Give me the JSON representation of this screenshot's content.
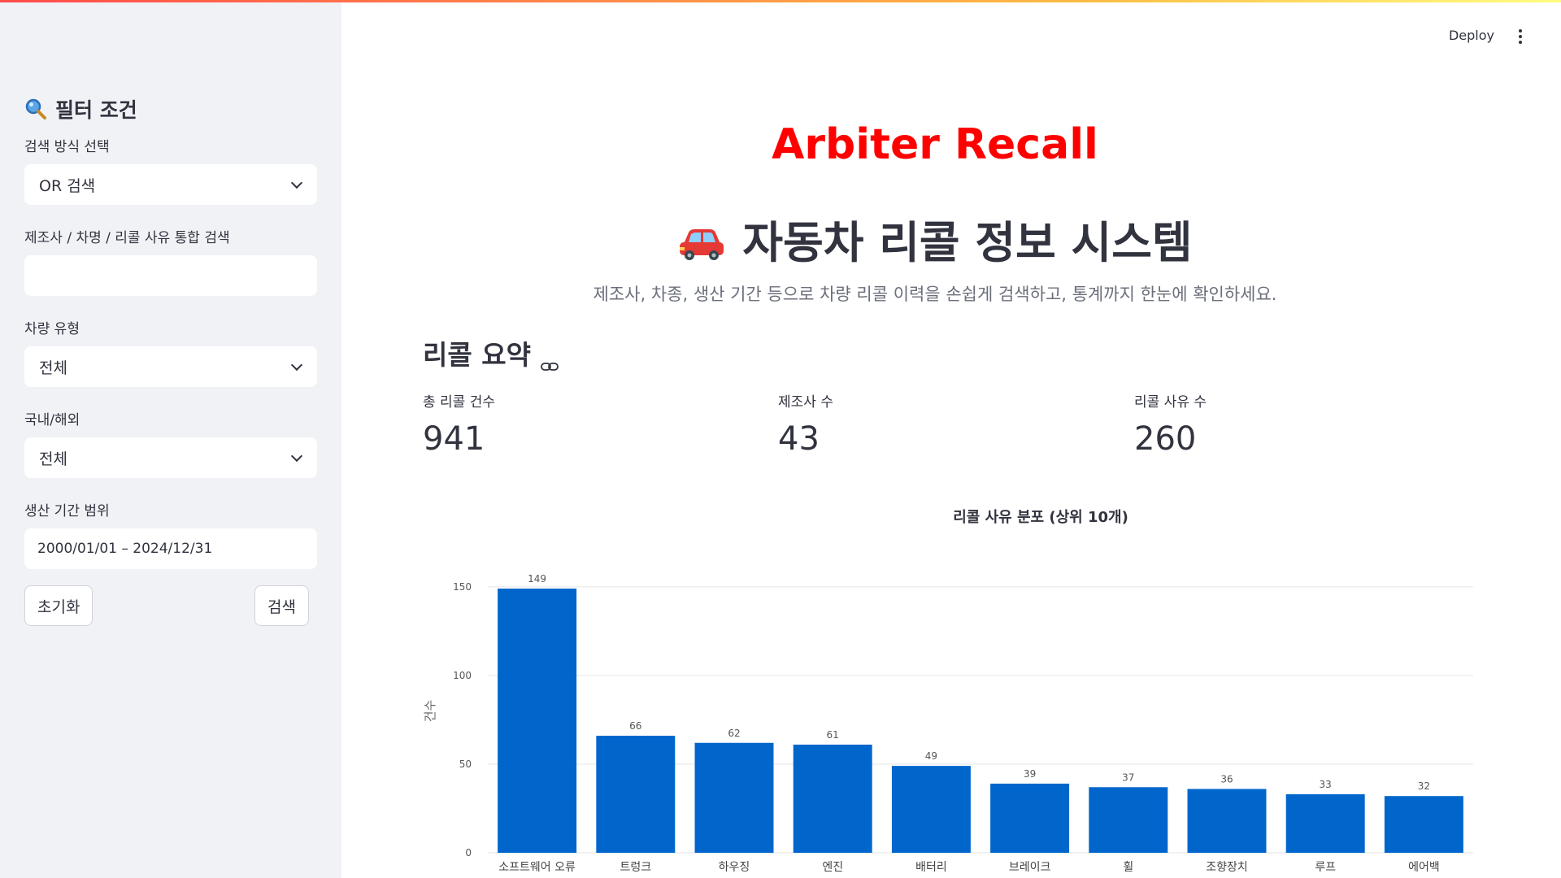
{
  "sidebar": {
    "title": "필터 조건",
    "search_mode": {
      "label": "검색 방식 선택",
      "value": "OR 검색"
    },
    "integrated_search": {
      "label": "제조사 / 차명 / 리콜 사유 통합 검색",
      "value": ""
    },
    "vehicle_type": {
      "label": "차량 유형",
      "value": "전체"
    },
    "domestic_foreign": {
      "label": "국내/해외",
      "value": "전체"
    },
    "production_period": {
      "label": "생산 기간 범위",
      "value": "2000/01/01 – 2024/12/31"
    },
    "reset_label": "초기화",
    "search_label": "검색"
  },
  "header": {
    "deploy_label": "Deploy"
  },
  "main": {
    "brand_title": "Arbiter Recall",
    "title": "자동차 리콜 정보 시스템",
    "subtitle": "제조사, 차종, 생산 기간 등으로 차량 리콜 이력을 손쉽게 검색하고, 통계까지 한눈에 확인하세요.",
    "summary_heading": "리콜 요약",
    "metrics": [
      {
        "label": "총 리콜 건수",
        "value": "941"
      },
      {
        "label": "제조사 수",
        "value": "43"
      },
      {
        "label": "리콜 사유 수",
        "value": "260"
      }
    ]
  },
  "colors": {
    "bar": "#0066cc",
    "accent_red": "#ff0000"
  },
  "chart_data": {
    "type": "bar",
    "title": "리콜 사유 분포 (상위 10개)",
    "xlabel": "",
    "ylabel": "건수",
    "categories": [
      "소프트웨어 오류",
      "트렁크",
      "하우징",
      "엔진",
      "배터리",
      "브레이크",
      "휠",
      "조향장치",
      "루프",
      "에어백"
    ],
    "values": [
      149,
      66,
      62,
      61,
      49,
      39,
      37,
      36,
      33,
      32
    ],
    "yticks": [
      0,
      50,
      100,
      150
    ],
    "ylim": [
      0,
      160
    ],
    "grid": true
  }
}
